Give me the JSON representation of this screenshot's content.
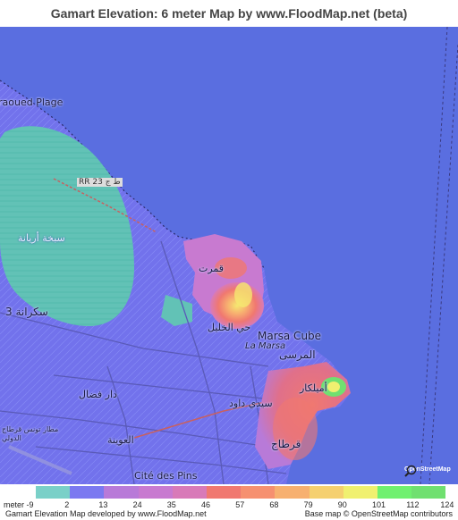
{
  "title": "Gamart Elevation: 6 meter Map by www.FloodMap.net (beta)",
  "map": {
    "labels": {
      "raoued_plage": "raoued Plage",
      "rr23": "RR 23 ط ج",
      "sebkha": "سبخة أريانة",
      "soukra3": "سكرانة 3",
      "gamart": "قمرت",
      "hay_khalil": "حي الخليل",
      "marsa_cube": "Marsa Cube",
      "la_marsa": "La Marsa",
      "al_marsa": "المرسى",
      "dar_fadhal": "دار فضال",
      "sidi_daoud": "سيدي داود",
      "amilcar": "أميلكار",
      "aouina": "العوينة",
      "carthage": "قرطاج",
      "airport": "مطار تونس قرطاج الدولي",
      "cite_des_pins": "Cité des Pins"
    },
    "osm_logo_text": "OpenStreetMap"
  },
  "legend": {
    "unit_label": "meter",
    "ticks": [
      "-9",
      "2",
      "13",
      "24",
      "35",
      "46",
      "57",
      "68",
      "79",
      "90",
      "101",
      "112",
      "124"
    ],
    "colors": [
      "#7ad0c8",
      "#7b79f0",
      "#b87ad8",
      "#c87ad0",
      "#d87ab8",
      "#f07870",
      "#f69070",
      "#f7b070",
      "#f5d070",
      "#f0f070",
      "#70f070",
      "#70e070"
    ]
  },
  "footer": {
    "left": "Gamart Elevation Map developed by www.FloodMap.net",
    "right": "Base map © OpenStreetMap contributors"
  }
}
